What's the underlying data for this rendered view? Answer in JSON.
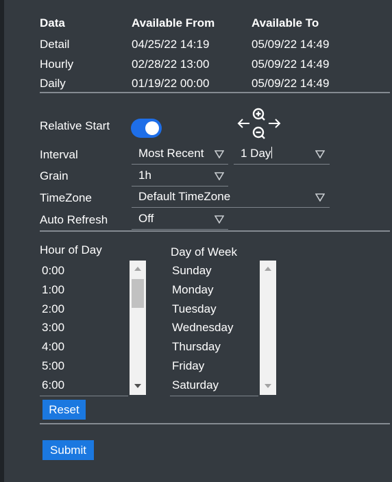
{
  "availability_table": {
    "headers": [
      "Data",
      "Available From",
      "Available To"
    ],
    "rows": [
      {
        "data": "Detail",
        "from": "04/25/22 14:19",
        "to": "05/09/22 14:49"
      },
      {
        "data": "Hourly",
        "from": "02/28/22 13:00",
        "to": "05/09/22 14:49"
      },
      {
        "data": "Daily",
        "from": "01/19/22 00:00",
        "to": "05/09/22 14:49"
      }
    ]
  },
  "form": {
    "relative_start_label": "Relative Start",
    "relative_start_on": true,
    "interval_label": "Interval",
    "interval_mode": "Most Recent",
    "interval_value": "1 Day",
    "grain_label": "Grain",
    "grain_value": "1h",
    "timezone_label": "TimeZone",
    "timezone_value": "Default TimeZone",
    "auto_refresh_label": "Auto Refresh",
    "auto_refresh_value": "Off"
  },
  "hour_of_day": {
    "label": "Hour of Day",
    "items": [
      "0:00",
      "1:00",
      "2:00",
      "3:00",
      "4:00",
      "5:00",
      "6:00"
    ]
  },
  "day_of_week": {
    "label": "Day of Week",
    "items": [
      "Sunday",
      "Monday",
      "Tuesday",
      "Wednesday",
      "Thursday",
      "Friday",
      "Saturday"
    ]
  },
  "buttons": {
    "reset": "Reset",
    "submit": "Submit"
  },
  "colors": {
    "background": "#343a40",
    "accent": "#1b78e0",
    "toggle_on": "#1e6ee8"
  }
}
